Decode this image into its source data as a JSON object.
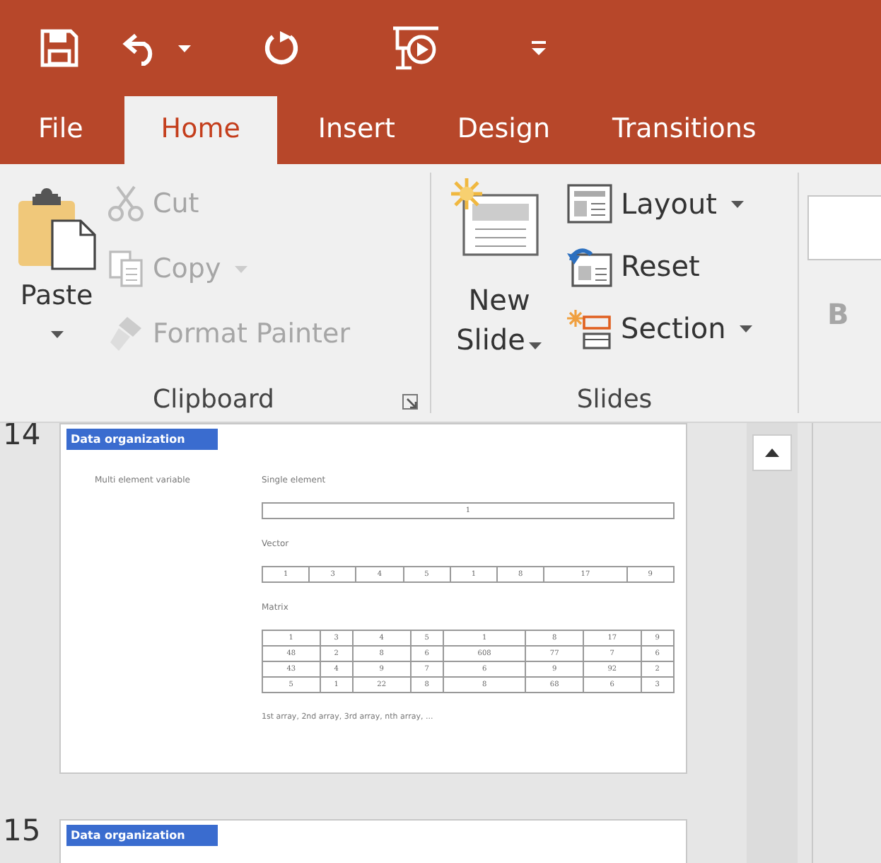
{
  "quick_access": {
    "undo_has_menu": true
  },
  "tabs": [
    {
      "label": "File",
      "selected": false
    },
    {
      "label": "Home",
      "selected": true
    },
    {
      "label": "Insert",
      "selected": false
    },
    {
      "label": "Design",
      "selected": false
    },
    {
      "label": "Transitions",
      "selected": false
    }
  ],
  "clipboard": {
    "paste": {
      "label": "Paste"
    },
    "commands": [
      {
        "kind": "cut",
        "label": "Cut",
        "disabled": true,
        "has_menu": false
      },
      {
        "kind": "copy",
        "label": "Copy",
        "disabled": true,
        "has_menu": true
      },
      {
        "kind": "painter",
        "label": "Format Painter",
        "disabled": true,
        "has_menu": false
      }
    ],
    "group_label": "Clipboard"
  },
  "slides_group": {
    "new_slide": {
      "label_lines": [
        "New",
        "Slide"
      ]
    },
    "commands": [
      {
        "kind": "layout",
        "label": "Layout",
        "has_menu": true
      },
      {
        "kind": "reset",
        "label": "Reset",
        "has_menu": false
      },
      {
        "kind": "section",
        "label": "Section",
        "has_menu": true
      }
    ],
    "group_label": "Slides"
  },
  "font_group": {
    "bold": {
      "label": "B",
      "disabled": true
    }
  },
  "slides": [
    {
      "number": "14",
      "title": "Data organization",
      "left_label": "Multi element variable",
      "sections": [
        {
          "label": "Single element",
          "rows": [
            [
              "1"
            ]
          ]
        },
        {
          "label": "Vector",
          "rows": [
            [
              "1",
              "3",
              "4",
              "5",
              "1",
              "8",
              "17",
              "9"
            ]
          ]
        },
        {
          "label": "Matrix",
          "rows": [
            [
              "1",
              "3",
              "4",
              "5",
              "1",
              "8",
              "17",
              "9"
            ],
            [
              "48",
              "2",
              "8",
              "6",
              "608",
              "77",
              "7",
              "6"
            ],
            [
              "43",
              "4",
              "9",
              "7",
              "6",
              "9",
              "92",
              "2"
            ],
            [
              "5",
              "1",
              "22",
              "8",
              "8",
              "68",
              "6",
              "3"
            ]
          ]
        }
      ],
      "footer": "1st array, 2nd array, 3rd array, nth array, ..."
    },
    {
      "number": "15",
      "title": "Data organization"
    }
  ]
}
